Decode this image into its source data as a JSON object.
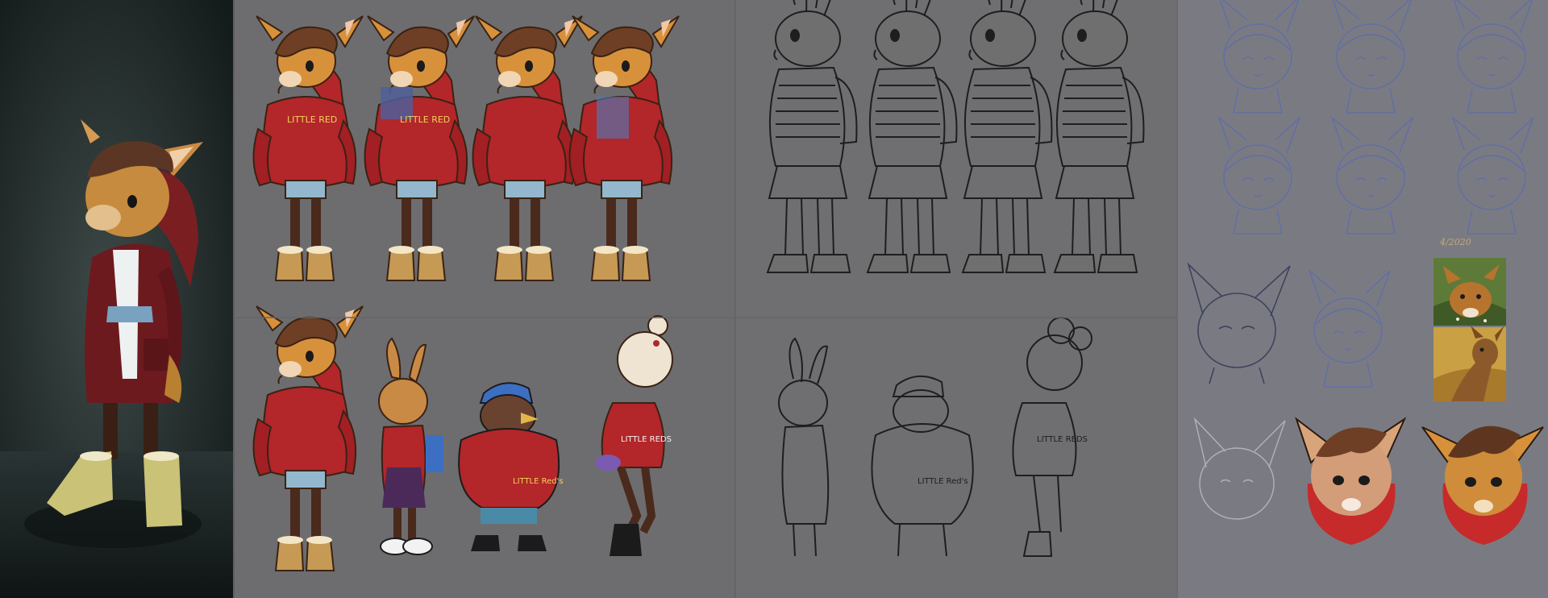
{
  "board": {
    "panels": [
      {
        "name": "render-3d",
        "subject": "fawn-character-render"
      },
      {
        "name": "color-turnaround",
        "subject": "fawn-outfit-variations"
      },
      {
        "name": "line-turnaround",
        "subject": "rabbit-lineart"
      },
      {
        "name": "color-lineup",
        "subject": "character-lineup"
      },
      {
        "name": "line-lineup",
        "subject": "lineup-lineart"
      },
      {
        "name": "head-sketches",
        "subject": "blue-pencil-head-studies"
      },
      {
        "name": "reference-photos",
        "subject": "deer-photos"
      }
    ],
    "hoodie_lettering": [
      "LITTLE RED",
      "LITTLE RED",
      "LITTLE Red's",
      "LITTLE REDS",
      "LITTLE Red's",
      "LITTLE REDS"
    ],
    "sketch_signature": "4/2020",
    "colors": {
      "background": "#6d6d6f",
      "render_bg": "#26302f",
      "sketch_bg": "#7a7b82",
      "hoodie_red": "#b3262a",
      "fur_orange": "#d8913b",
      "hair_brown": "#6e3f24",
      "boot_tan": "#c69a55",
      "pencil_blue": "#5a6bb0"
    }
  }
}
